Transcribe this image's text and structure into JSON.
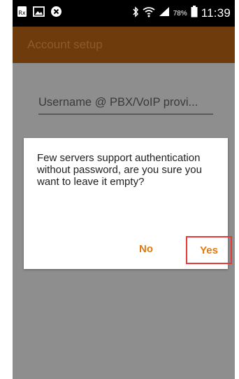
{
  "status_bar": {
    "left_icons": [
      "notification-icon",
      "image-icon",
      "close-circle-icon"
    ],
    "right_icons": [
      "bluetooth-icon",
      "wifi-icon",
      "signal-icon",
      "battery-icon"
    ],
    "battery_percent": "78%",
    "time": "11:39"
  },
  "app_bar": {
    "title": "Account setup"
  },
  "form": {
    "username_placeholder": "Username @ PBX/VoIP provi..."
  },
  "dialog": {
    "message": "Few servers support authentication without password, are you sure you want to leave it empty?",
    "no_label": "No",
    "yes_label": "Yes"
  },
  "colors": {
    "app_bar": "#6e3c0c",
    "accent": "#e07a10",
    "highlight_border": "#e33a3a",
    "dim_background": "#8e8e8e"
  }
}
